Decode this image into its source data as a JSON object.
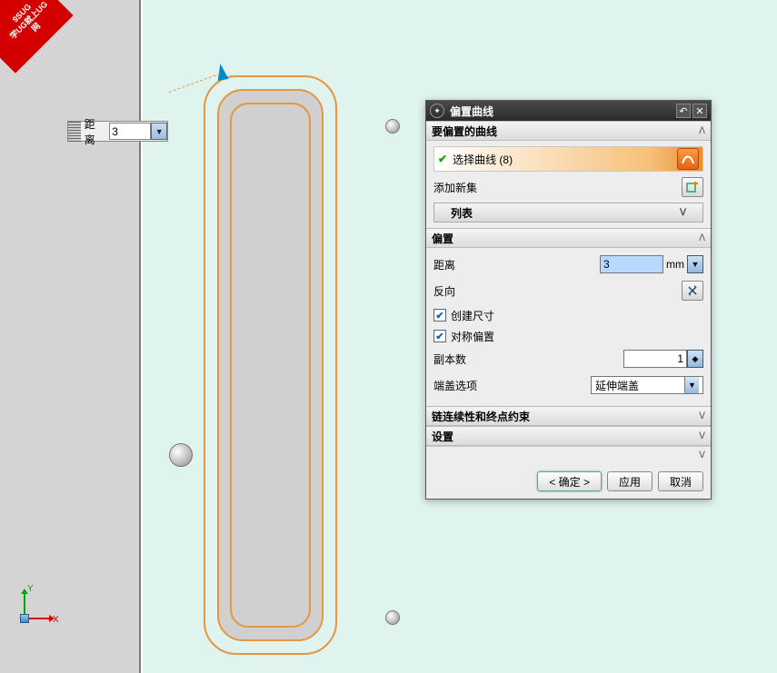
{
  "watermark": {
    "line1": "9SUG",
    "line2": "学UG就上UG网"
  },
  "dim_input": {
    "label": "距离",
    "value": "3"
  },
  "coord": {
    "x": "X",
    "y": "Y"
  },
  "dialog": {
    "title": "偏置曲线",
    "sections": {
      "curves_to_offset": {
        "header": "要偏置的曲线",
        "select_label": "选择曲线 (8)",
        "add_new_set": "添加新集",
        "list_header": "列表"
      },
      "offset": {
        "header": "偏置",
        "distance_label": "距离",
        "distance_value": "3",
        "distance_unit": "mm",
        "reverse_label": "反向",
        "create_dim_label": "创建尺寸",
        "symmetric_label": "对称偏置",
        "copies_label": "副本数",
        "copies_value": "1",
        "endcap_label": "端盖选项",
        "endcap_value": "延伸端盖"
      },
      "chain": {
        "header": "链连续性和终点约束"
      },
      "settings": {
        "header": "设置"
      }
    },
    "buttons": {
      "ok": "< 确定 >",
      "apply": "应用",
      "cancel": "取消"
    }
  }
}
